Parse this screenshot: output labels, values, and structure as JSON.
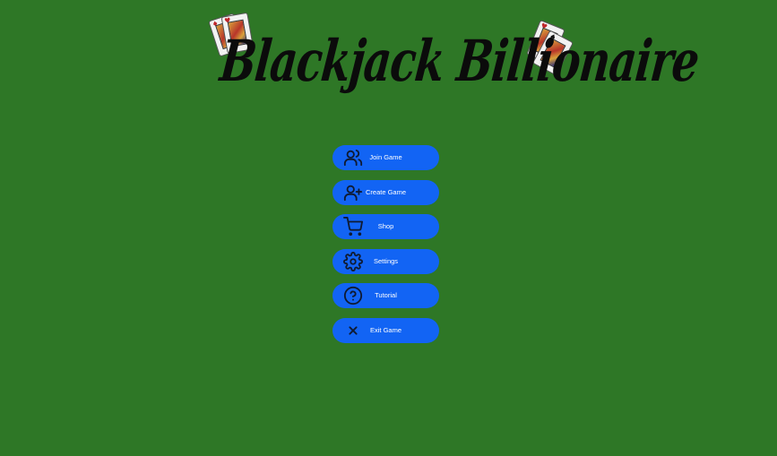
{
  "title": "Blackjack Billionaire",
  "colors": {
    "background": "#2e7726",
    "button": "#1264f4",
    "button_text": "#ffffff",
    "icon": "#0f1b33",
    "title": "#0b0b0b"
  },
  "decorations": {
    "left_card": "playing-card-jack",
    "right_card": "playing-card-queen"
  },
  "menu": [
    {
      "id": "join",
      "label": "Join Game",
      "icon": "users-icon"
    },
    {
      "id": "create",
      "label": "Create Game",
      "icon": "user-plus-icon"
    },
    {
      "id": "shop",
      "label": "Shop",
      "icon": "shopping-cart-icon"
    },
    {
      "id": "settings",
      "label": "Settings",
      "icon": "gear-icon"
    },
    {
      "id": "tutorial",
      "label": "Tutorial",
      "icon": "help-circle-icon"
    },
    {
      "id": "exit",
      "label": "Exit Game",
      "icon": "close-icon"
    }
  ]
}
